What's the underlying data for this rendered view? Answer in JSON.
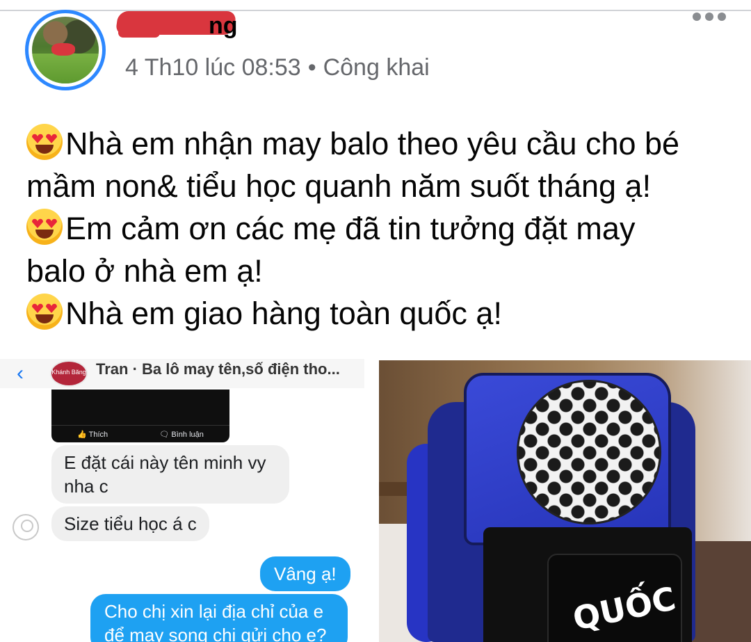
{
  "post": {
    "author_name": "ng",
    "timestamp": "4 Th10 lúc 08:53",
    "separator": "•",
    "audience": "Công khai",
    "lines": [
      "Nhà em nhận may balo theo yêu cầu cho bé",
      "mầm non& tiểu học quanh năm suốt tháng ạ!",
      "Em cảm ơn các mẹ đã tin tưởng đặt may",
      "balo ở nhà em ạ!",
      "Nhà em giao hàng toàn quốc ạ!"
    ]
  },
  "chat": {
    "title": "Tran · Ba lô may tên,số điện tho...",
    "avatar_text": "Khánh Băng",
    "card_actions": [
      "Thích",
      "Bình luận"
    ],
    "messages": [
      {
        "from": "customer",
        "text": "E đặt cái này tên minh vy nha c"
      },
      {
        "from": "customer",
        "text": "Size tiểu học á c"
      },
      {
        "from": "shop",
        "text": "Vâng ạ!"
      },
      {
        "from": "shop",
        "text": "Cho chị xin lại địa chỉ của e để may song chị gửi cho e?"
      }
    ]
  },
  "photo": {
    "bag_text": "QUỐC"
  },
  "icons": [
    "more-options-icon",
    "heart-eyes-emoji-icon",
    "back-arrow-icon",
    "contact-icon",
    "like-icon",
    "comment-icon"
  ],
  "colors": {
    "link_blue": "#2d88ff",
    "bubble_blue": "#1ea1f2",
    "meta_gray": "#65676b"
  }
}
